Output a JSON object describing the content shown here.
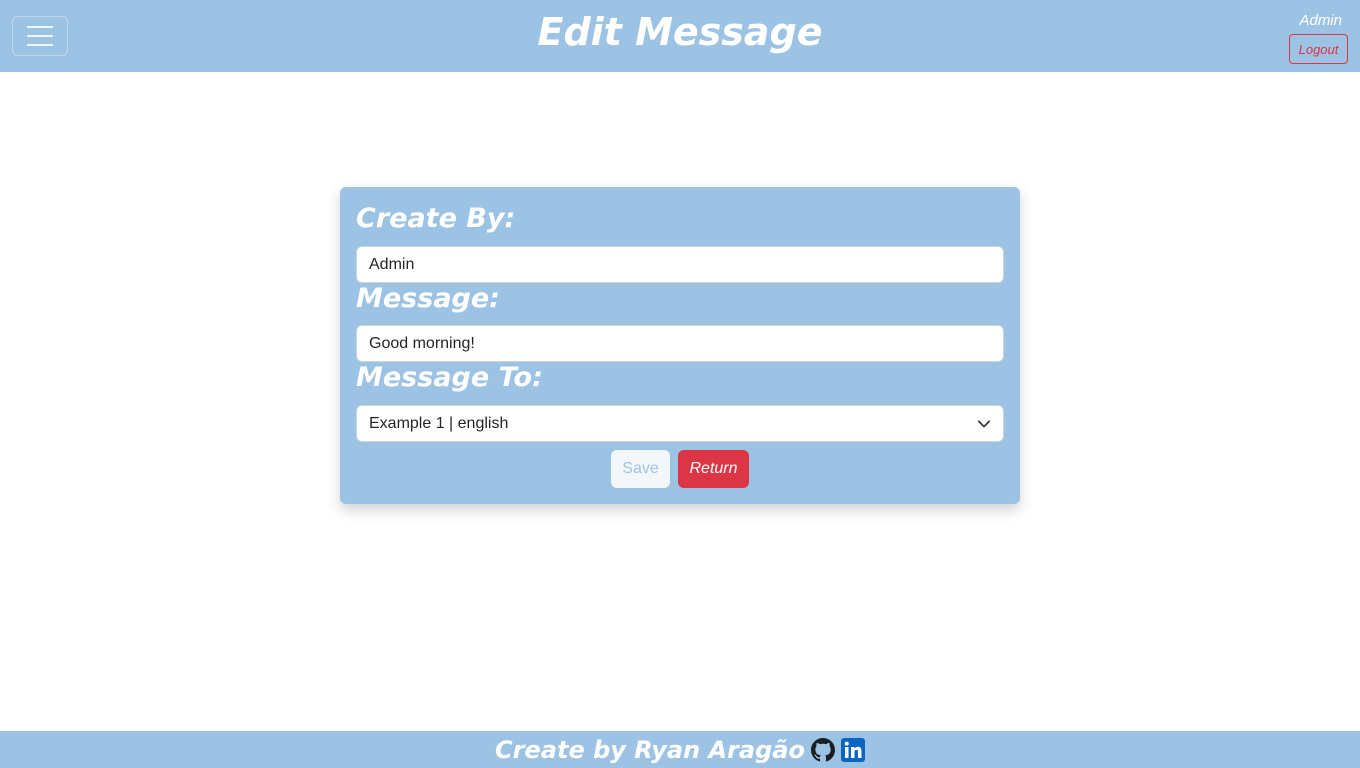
{
  "header": {
    "title": "Edit Message",
    "user": "Admin",
    "logout_label": "Logout",
    "menu_icon": "hamburger-menu-icon"
  },
  "form": {
    "created_by_label": "Create By:",
    "created_by_value": "Admin",
    "message_label": "Message:",
    "message_value": "Good morning!",
    "message_to_label": "Message To:",
    "message_to_selected": "Example 1 | english",
    "save_label": "Save",
    "return_label": "Return"
  },
  "footer": {
    "text": "Create by Ryan Aragão",
    "icons": [
      "github-icon",
      "linkedin-icon"
    ]
  },
  "colors": {
    "primary": "#9dc3e4",
    "danger": "#dc3545",
    "text_light": "#ffffff"
  }
}
